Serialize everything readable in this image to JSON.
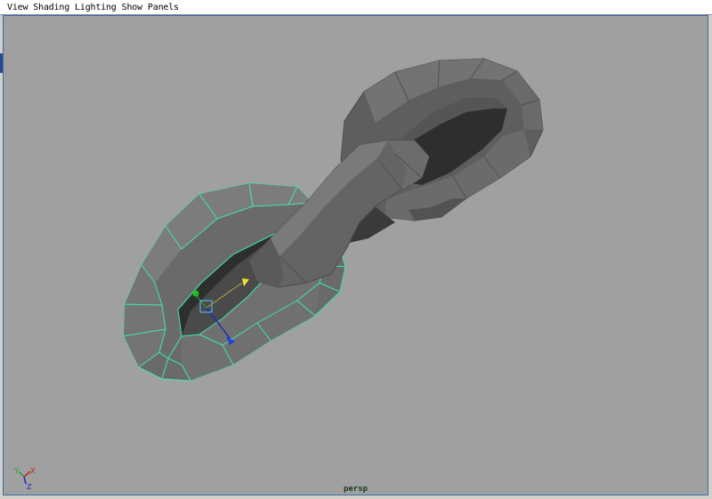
{
  "menu": {
    "items": [
      {
        "label": "View"
      },
      {
        "label": "Shading"
      },
      {
        "label": "Lighting"
      },
      {
        "label": "Show"
      },
      {
        "label": "Panels"
      }
    ]
  },
  "viewport": {
    "camera_label": "persp",
    "background_color": "#a0a0a0",
    "selection_wire_color": "#3ee8b0"
  },
  "axis_gizmo": {
    "labels": [
      "X",
      "Y",
      "Z"
    ]
  }
}
